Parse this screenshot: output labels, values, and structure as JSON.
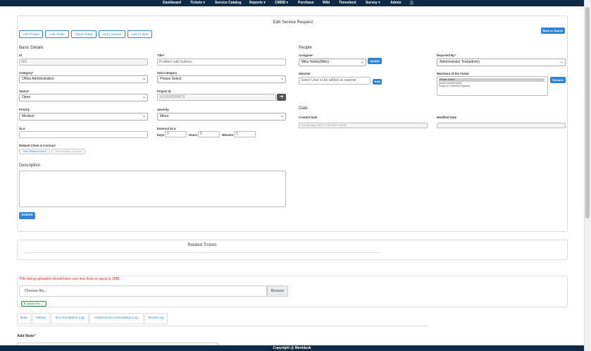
{
  "nav": {
    "items": [
      "Dashboard",
      "Tickets ▾",
      "Service Catalog",
      "Reports ▾",
      "CMDB ▾",
      "Purchase",
      "Wiki",
      "Timesheet",
      "Survey ▾",
      "Admin"
    ],
    "info_icon": "info-circle-icon"
  },
  "page": {
    "title": "Edit Service Request",
    "back_button": "Back to Search",
    "action_buttons": [
      "Link Project",
      "Link Ticket",
      "Clone Ticket",
      "Link Contract",
      "Link CI Item"
    ]
  },
  "basic": {
    "heading": "Basic Details",
    "id_label": "Id",
    "id_value": "863",
    "title_label": "Title",
    "title_value": "Problem with buttons",
    "category_label": "Category",
    "category_value": "Office Administration",
    "subcategory_label": "Sub-Category",
    "subcategory_value": "Please Select",
    "status_label": "Status",
    "status_value": "Open",
    "project_label": "Project Id",
    "project_value": "1510550258879",
    "priority_label": "Priority",
    "priority_value": "Medium",
    "severity_label": "Severity",
    "severity_value": "Minor",
    "sla_label": "SLA",
    "ext_sla_label": "External SLA",
    "days_label": "Days",
    "days_value": "0",
    "hours_label": "Hours",
    "hours_value": "0",
    "minutes_label": "Minutes",
    "minutes_value": "0",
    "related_label": "Related Citem & Contract",
    "view_citem": "View Related Citem",
    "view_contract": "View Related Contract",
    "description_label": "Description",
    "submit": "Submit"
  },
  "people": {
    "heading": "People",
    "assignee_label": "Assignee",
    "assignee_value": "Mike Noble(Mike)",
    "update_button": "Update",
    "reported_label": "Reported By",
    "reported_value": "Administrator Test(admin)",
    "watcher_label": "Watcher",
    "watcher_placeholder": "Select User to be added as watcher",
    "add_button": "Add",
    "watchers_label": "Watchers of the Ticket",
    "watchers_list": [
      "Please Select",
      "Sarath Anand(Sarith)",
      "Fargason refaeek(Fargason)"
    ],
    "remove_button": "Remove"
  },
  "date": {
    "heading": "Date",
    "created_label": "Created Date",
    "created_value": "Thu 06 May 2021 17:00 GMT+05:30",
    "modified_label": "Modified Date",
    "modified_value": ""
  },
  "related_tickets": {
    "heading": "Related Tickets"
  },
  "upload": {
    "warning": "*File being uploaded should have size less than or equal to 2MB",
    "choose_file": "Choose file...",
    "browse": "Browse",
    "upload_button": "Upload File"
  },
  "tabs": [
    "Note",
    "History",
    "SLA Escalation Log",
    "External SLA Escalation Log",
    "Email Log"
  ],
  "note": {
    "label": "Add Note"
  },
  "footer": {
    "text": "Copyright @ Mentdesk"
  },
  "colors": {
    "nav": "#0f2a44",
    "primary": "#2f86d6",
    "required": "#d9302c"
  }
}
